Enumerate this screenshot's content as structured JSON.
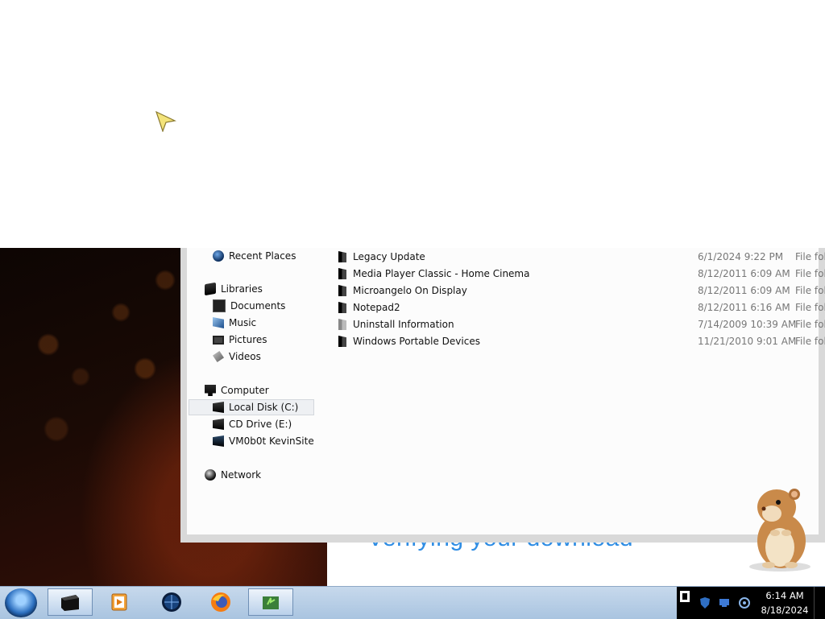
{
  "navigation": {
    "items": [
      {
        "label": "Recent Places",
        "icon": "recent-places-icon"
      },
      {
        "label": "Libraries",
        "icon": "libraries-icon"
      },
      {
        "label": "Documents",
        "icon": "documents-icon"
      },
      {
        "label": "Music",
        "icon": "music-icon"
      },
      {
        "label": "Pictures",
        "icon": "pictures-icon"
      },
      {
        "label": "Videos",
        "icon": "videos-icon"
      },
      {
        "label": "Computer",
        "icon": "computer-icon"
      },
      {
        "label": "Local Disk (C:)",
        "icon": "hard-disk-icon",
        "selected": true
      },
      {
        "label": "CD Drive (E:)",
        "icon": "cd-drive-icon"
      },
      {
        "label": "VM0b0t KevinSite",
        "icon": "network-drive-icon"
      },
      {
        "label": "Network",
        "icon": "network-icon"
      }
    ]
  },
  "files": [
    {
      "name": "Legacy Update",
      "date": "6/1/2024 9:22 PM",
      "type": "File folder"
    },
    {
      "name": "Media Player Classic - Home Cinema",
      "date": "8/12/2011 6:09 AM",
      "type": "File folder"
    },
    {
      "name": "Microangelo On Display",
      "date": "8/12/2011 6:09 AM",
      "type": "File folder"
    },
    {
      "name": "Notepad2",
      "date": "8/12/2011 6:16 AM",
      "type": "File folder"
    },
    {
      "name": "Uninstall Information",
      "date": "7/14/2009 10:39 AM",
      "type": "File folder"
    },
    {
      "name": "Windows Portable Devices",
      "date": "11/21/2010 9:01 AM",
      "type": "File folder"
    }
  ],
  "background_window": {
    "text": "Verifying your download"
  },
  "taskbar": {
    "apps": [
      {
        "icon": "windows-explorer-icon",
        "active": true
      },
      {
        "icon": "media-player-icon",
        "active": false
      },
      {
        "icon": "globe-browser-icon",
        "active": false
      },
      {
        "icon": "firefox-icon",
        "active": false
      },
      {
        "icon": "installer-icon",
        "active": true
      }
    ],
    "tray_icons": [
      "action-center-icon",
      "shield-icon",
      "network-tray-icon",
      "volume-icon"
    ],
    "clock": {
      "time": "6:14 AM",
      "date": "8/18/2024"
    }
  },
  "colors": {
    "taskbar": "#b9cfe7",
    "selection": "#eef0f3",
    "accent_text": "#2f8de4"
  }
}
